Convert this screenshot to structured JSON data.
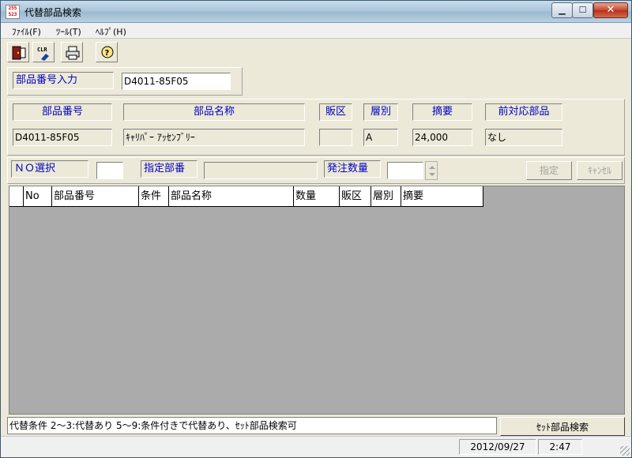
{
  "window": {
    "title": "代替部品検索",
    "icon_lines": [
      "255",
      "523"
    ]
  },
  "menu": [
    {
      "label": "ﾌｧｲﾙ(F)"
    },
    {
      "label": "ﾂｰﾙ(T)"
    },
    {
      "label": "ﾍﾙﾌﾟ(H)"
    }
  ],
  "toolbar": {
    "exit_icon": "exit-icon",
    "clear_label": "CLR",
    "print_icon": "printer-icon",
    "help_icon": "help-icon"
  },
  "part_input": {
    "label": "部品番号入力",
    "value": "D4011-85F05"
  },
  "result": {
    "headers": {
      "part_number": "部品番号",
      "part_name": "部品名称",
      "sales_area": "販区",
      "tier": "層別",
      "summary": "摘要",
      "prev_part": "前対応部品"
    },
    "values": {
      "part_number": "D4011-85F05",
      "part_name": "ｷｬﾘﾊﾟｰ ｱｯｾﾝﾌﾞﾘｰ",
      "sales_area": "",
      "tier": "A",
      "summary": "24,000",
      "prev_part": "なし"
    }
  },
  "selection": {
    "no_label": "ＮＯ選択",
    "no_value": "",
    "designated_label": "指定部番",
    "designated_value": "",
    "qty_label": "発注数量",
    "qty_value": "",
    "designate_button": "指定",
    "cancel_button": "ｷｬﾝｾﾙ"
  },
  "grid": {
    "columns": [
      "No",
      "部品番号",
      "条件",
      "部品名称",
      "数量",
      "販区",
      "層別",
      "摘要"
    ],
    "rows": []
  },
  "status": {
    "message": "代替条件 2～3:代替あり 5～9:条件付きで代替あり、ｾｯﾄ部品検索可",
    "set_search_button": "ｾｯﾄ部品検索",
    "date": "2012/09/27",
    "time": "2:47"
  },
  "colors": {
    "label_text": "#0000c0",
    "face": "#ece9d8",
    "grid_bg": "#ababab"
  }
}
